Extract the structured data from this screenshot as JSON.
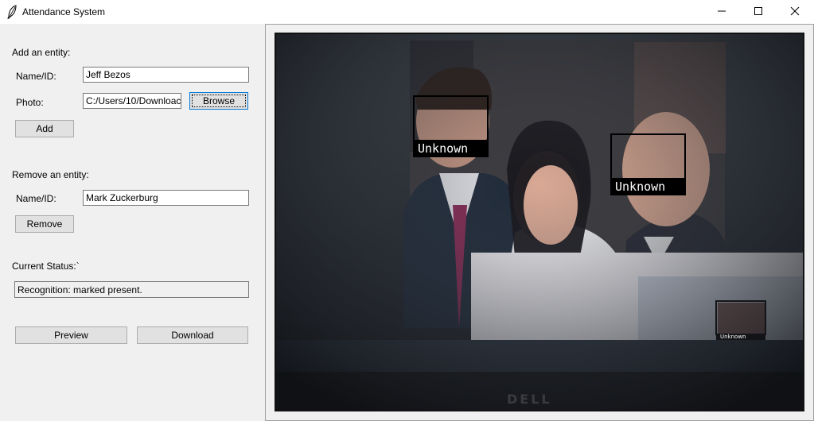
{
  "window": {
    "title": "Attendance System",
    "icon": "feather-icon",
    "controls": [
      "minimize-icon",
      "maximize-icon",
      "close-icon"
    ]
  },
  "add_section": {
    "heading": "Add an entity:",
    "name_label": "Name/ID:",
    "name_value": "Jeff Bezos",
    "photo_label": "Photo:",
    "photo_value": "C:/Users/10/Downloac",
    "browse_label": "Browse",
    "add_label": "Add"
  },
  "remove_section": {
    "heading": "Remove an entity:",
    "name_label": "Name/ID:",
    "name_value": "Mark Zuckerburg",
    "remove_label": "Remove"
  },
  "status_section": {
    "heading": "Current Status:`",
    "value": "Recognition:  marked present."
  },
  "actions": {
    "preview_label": "Preview",
    "download_label": "Download"
  },
  "video": {
    "detections": [
      {
        "label": "Unknown"
      },
      {
        "label": "Unknown"
      }
    ],
    "mini_label": "Unknown",
    "monitor_brand": "DELL"
  }
}
